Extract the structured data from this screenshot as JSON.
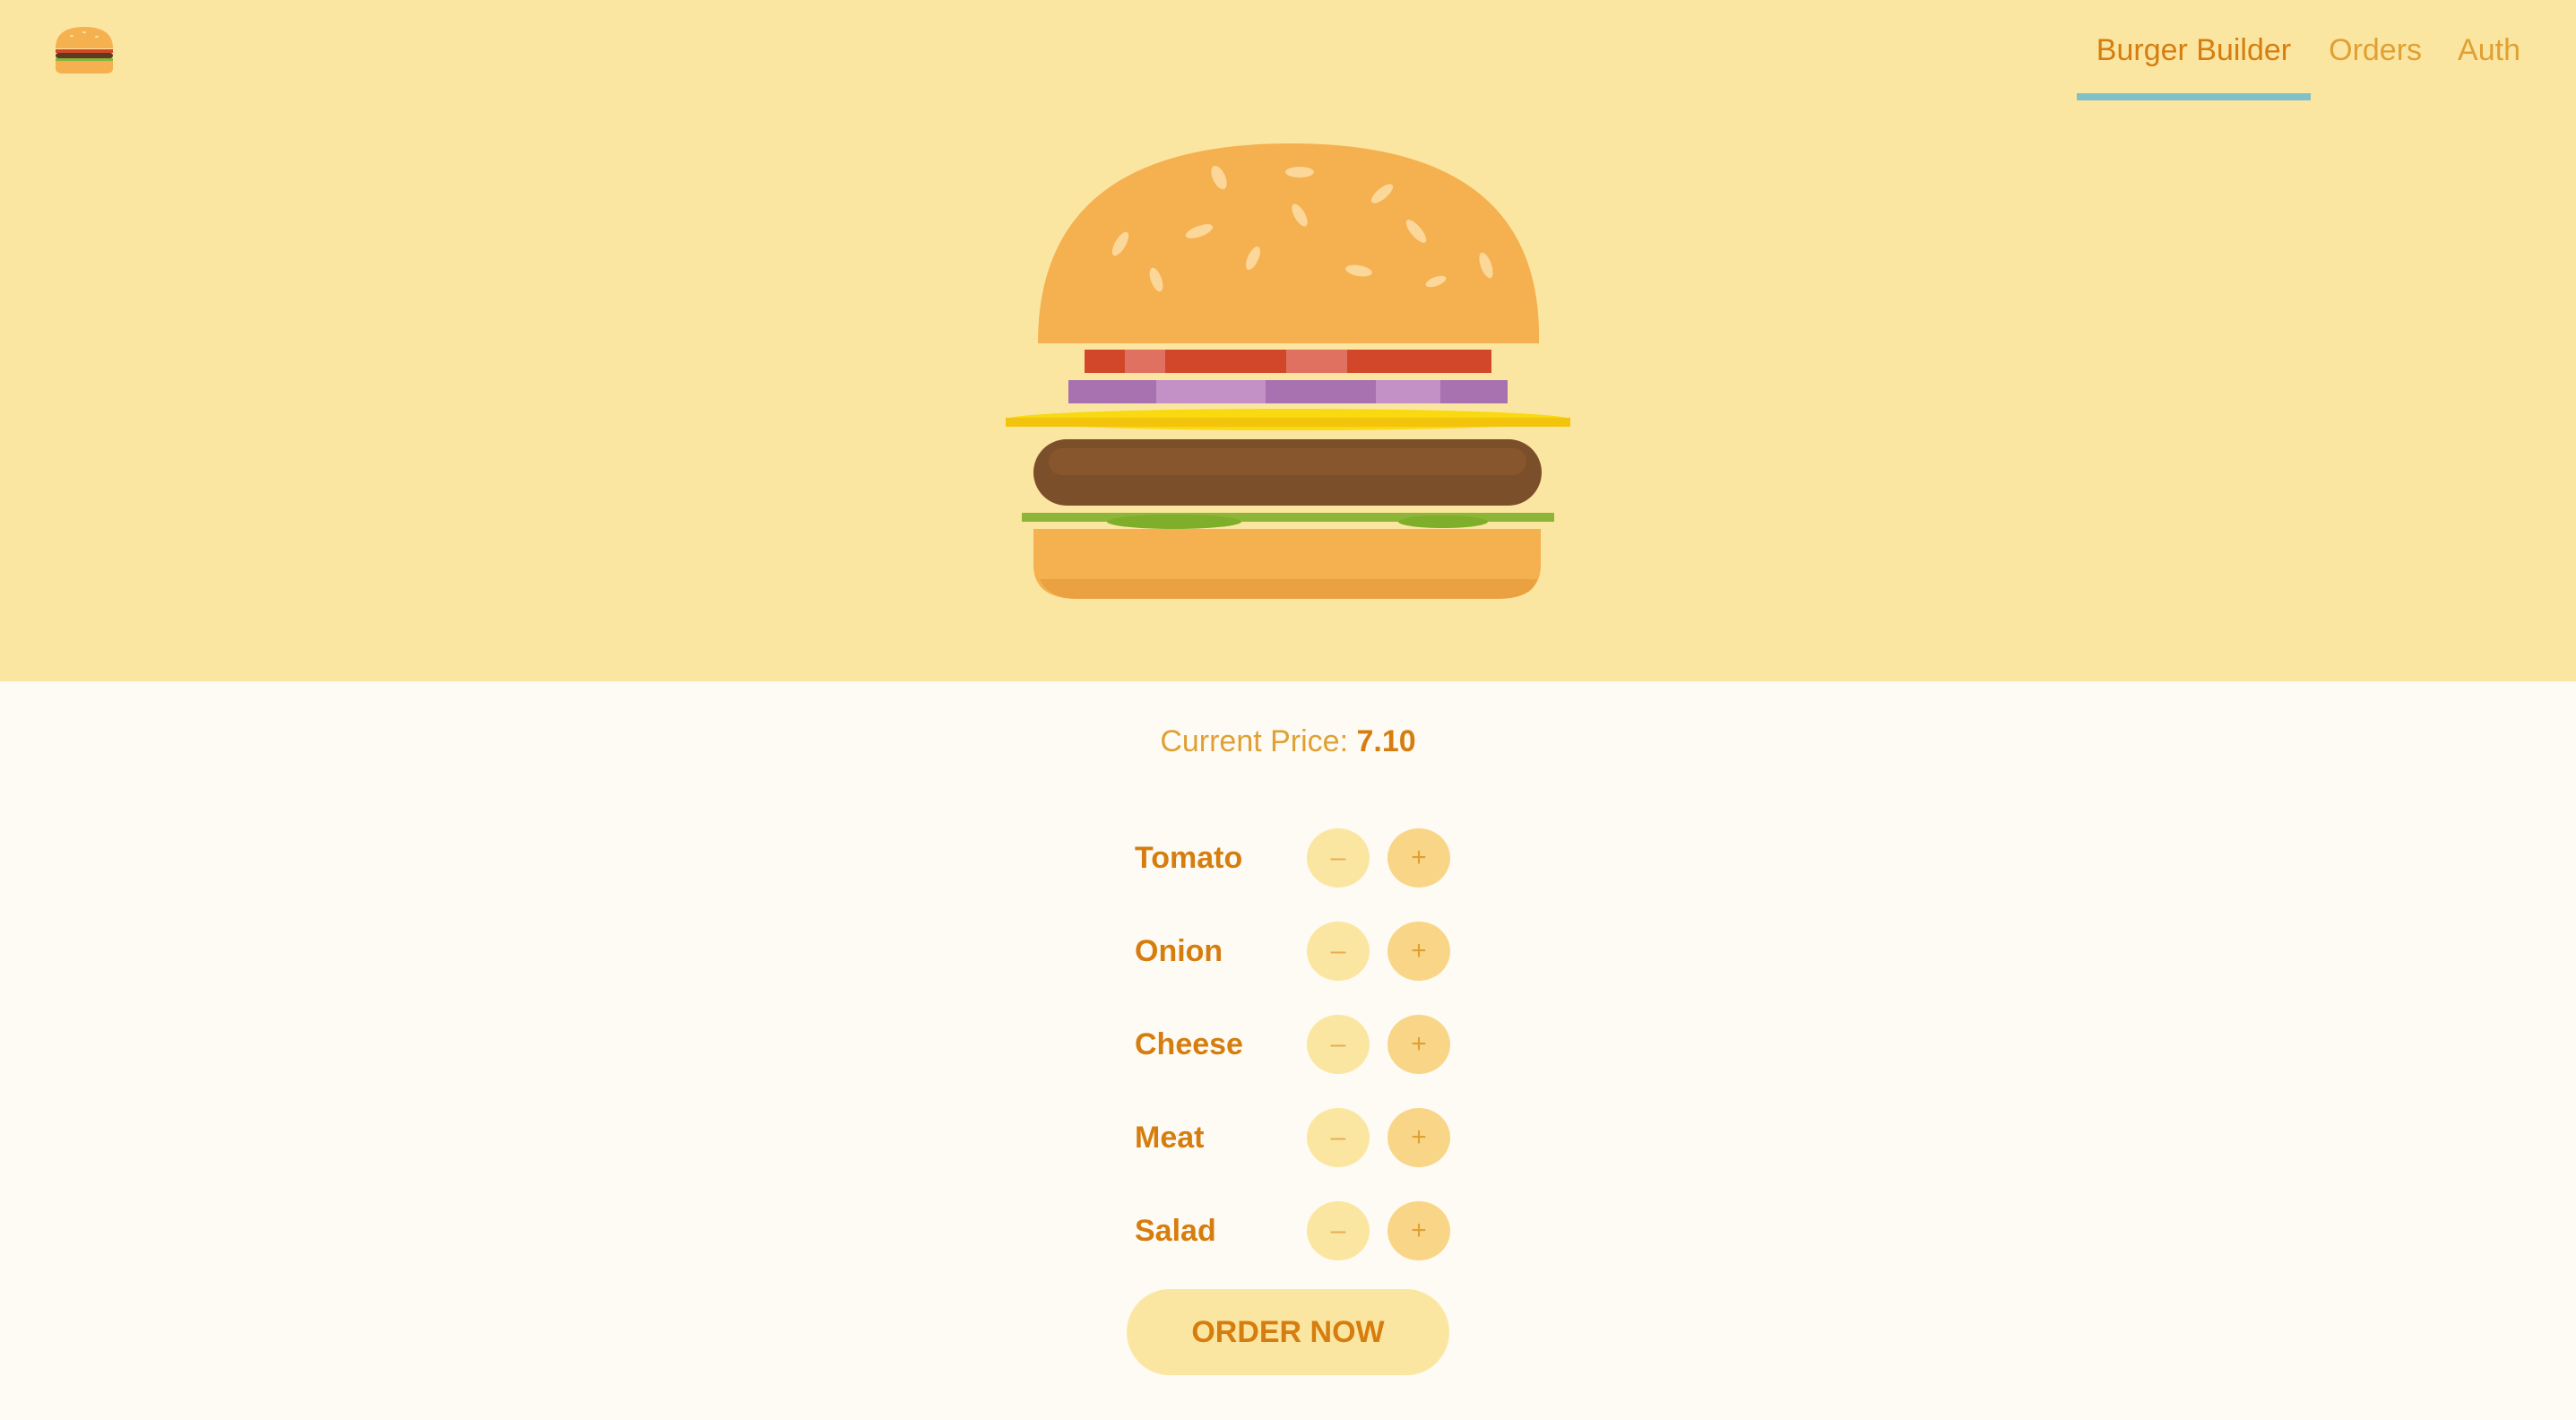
{
  "nav": {
    "items": [
      {
        "label": "Burger Builder",
        "active": true
      },
      {
        "label": "Orders",
        "active": false
      },
      {
        "label": "Auth",
        "active": false
      }
    ]
  },
  "logo": {
    "icon": "burger-logo-icon"
  },
  "price": {
    "label": "Current Price:",
    "value": "7.10"
  },
  "controls": [
    {
      "label": "Tomato",
      "less": "–",
      "more": "+"
    },
    {
      "label": "Onion",
      "less": "–",
      "more": "+"
    },
    {
      "label": "Cheese",
      "less": "–",
      "more": "+"
    },
    {
      "label": "Meat",
      "less": "–",
      "more": "+"
    },
    {
      "label": "Salad",
      "less": "–",
      "more": "+"
    }
  ],
  "order_button": {
    "label": "ORDER NOW"
  },
  "colors": {
    "top_background": "#fbe6a1",
    "page_background": "#fefbf4",
    "accent": "#d67d0f",
    "nav_underline": "#7fc0c9"
  }
}
